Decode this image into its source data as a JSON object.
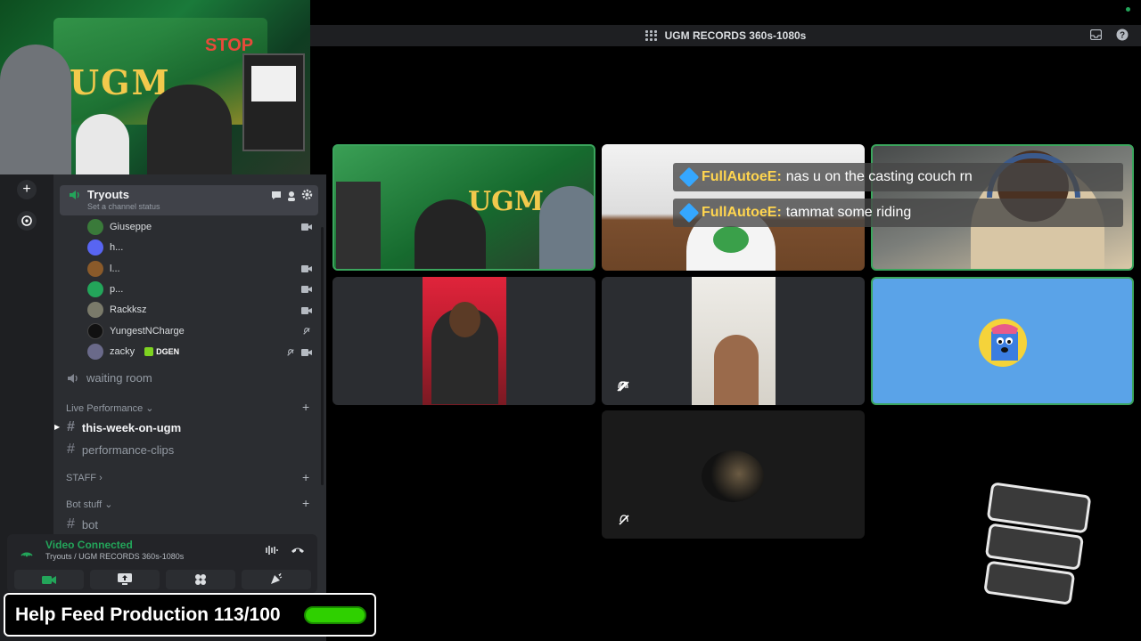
{
  "window": {
    "title": "UGM RECORDS 360s-1080s"
  },
  "webcam": {
    "logo": "UGM",
    "sign": "STOP"
  },
  "voice_channel": {
    "name": "Tryouts",
    "status": "Set a channel status"
  },
  "members": [
    {
      "name": "Giuseppe",
      "color": "#3a7a3a"
    },
    {
      "name": "h...",
      "color": "#5865f2"
    },
    {
      "name": "l...",
      "color": "#8a5a2a"
    },
    {
      "name": "p...",
      "color": "#23a55a"
    },
    {
      "name": "Rackksz",
      "color": "#7a7a6a"
    },
    {
      "name": "YungestNCharge",
      "color": "#111111"
    },
    {
      "name": "zacky",
      "color": "#6a6a8a",
      "badge": "DGEN"
    }
  ],
  "channels": {
    "waiting_room": "waiting room",
    "live_category": "Live Performance",
    "text1": "this-week-on-ugm",
    "text2": "performance-clips",
    "staff_category": "STAFF",
    "bot_category": "Bot stuff",
    "bot": "bot"
  },
  "voice_panel": {
    "title": "Video Connected",
    "subtitle": "Tryouts / UGM RECORDS 360s-1080s"
  },
  "banner": {
    "text": "Help Feed Production 113/100",
    "progress": 1.0
  },
  "chat_overlay": [
    {
      "user": "FullAutoeE:",
      "message": "nas u on the casting couch rn"
    },
    {
      "user": "FullAutoeE:",
      "message": "tammat some riding"
    }
  ],
  "colors": {
    "accent_green": "#23a55a",
    "speaking_border": "#3ba55d",
    "tile_blue": "#5aa3e8",
    "banner_green": "#2fd000"
  }
}
